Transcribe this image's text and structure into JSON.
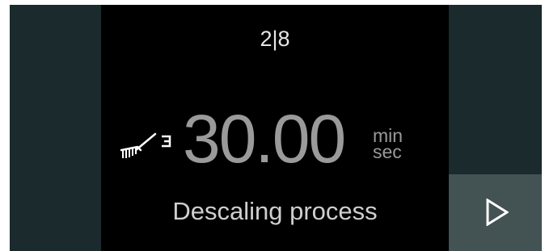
{
  "header": {
    "step_indicator": "2|8"
  },
  "timer": {
    "value": "30.00",
    "unit_minutes": "min",
    "unit_seconds": "sec"
  },
  "process": {
    "label": "Descaling process"
  },
  "icons": {
    "process_icon": "brush-icon",
    "next_icon": "play-arrow-icon"
  },
  "colors": {
    "screen_background": "#000000",
    "side_panel": "#1b2b2d",
    "next_button": "#435252",
    "timer_text": "#9a9a9a",
    "label_text": "#cfcfcf"
  }
}
